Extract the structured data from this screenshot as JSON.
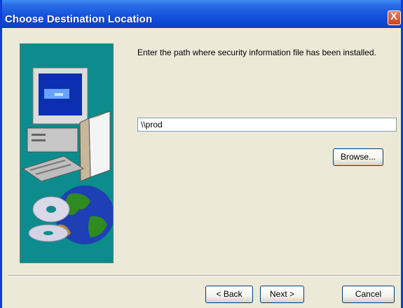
{
  "window": {
    "title": "Choose Destination Location",
    "close_glyph": "X"
  },
  "main": {
    "instruction": "Enter the path where security information file has been installed.",
    "path_value": "\\\\prod"
  },
  "buttons": {
    "browse": "Browse...",
    "back": "< Back",
    "next": "Next >",
    "cancel": "Cancel"
  },
  "icons": {
    "computer_art": "computer-globe-cd-illustration",
    "close": "close-icon"
  },
  "colors": {
    "titlebar": "#1652dc",
    "art_background": "#0c8c8c",
    "dialog_background": "#ece9d8"
  }
}
